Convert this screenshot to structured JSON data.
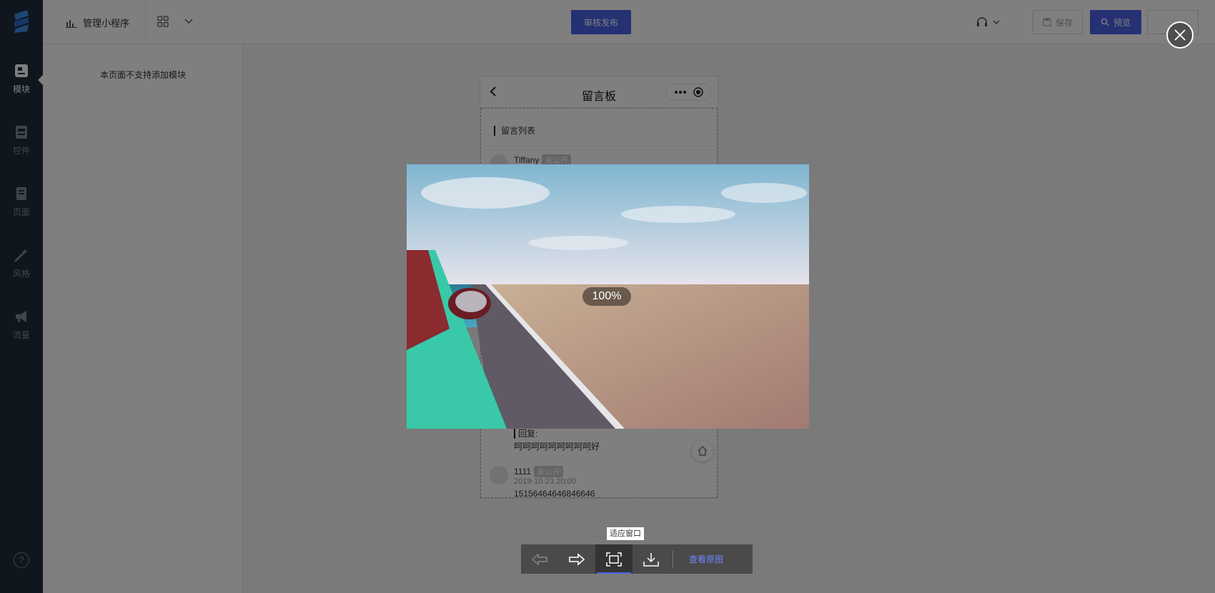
{
  "rail": {
    "items": [
      {
        "label": "模块",
        "icon": "module-icon",
        "active": true
      },
      {
        "label": "控件",
        "icon": "widget-icon",
        "active": false
      },
      {
        "label": "页面",
        "icon": "page-icon",
        "active": false
      },
      {
        "label": "风格",
        "icon": "magic-wand-icon",
        "active": false
      },
      {
        "label": "流量",
        "icon": "megaphone-icon",
        "active": false
      }
    ],
    "help": "?"
  },
  "topbar": {
    "manage_label": "管理小程序",
    "publish_label": "审核发布",
    "save_label": "保存",
    "preview_label": "预览"
  },
  "panel": {
    "note": "本页面不支持添加模块"
  },
  "phone": {
    "title": "留言板",
    "section_title": "留言列表",
    "comments": [
      {
        "name": "Tiffany",
        "badge": "未公开",
        "time": "",
        "text": ""
      },
      {
        "name": "1111",
        "badge": "未公开",
        "time": "2019-10-23 20:00",
        "text": "15156464646846646"
      }
    ],
    "reply_label": "回复:",
    "reply_text": "呵呵呵呵呵呵呵呵呵好"
  },
  "viewer": {
    "zoom": "100%",
    "tooltip": "适应窗口",
    "view_original_label": "查看原图"
  },
  "colors": {
    "rail_bg": "#1f2d3d",
    "primary": "#4b63e6",
    "link": "#6d86ff"
  }
}
